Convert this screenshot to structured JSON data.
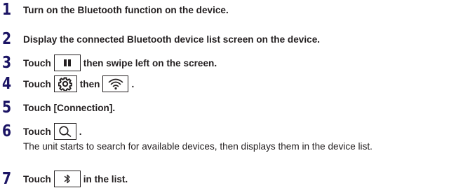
{
  "steps": [
    {
      "number": "1",
      "text": "Turn on the Bluetooth function on the device."
    },
    {
      "number": "2",
      "text": "Display the connected Bluetooth device list screen on the device."
    },
    {
      "number": "3",
      "before": "Touch",
      "after": "then swipe left on the screen.",
      "icon": "pause-icon"
    },
    {
      "number": "4",
      "before": "Touch",
      "middle": "then",
      "after": ".",
      "icon": "gear-icon",
      "icon2": "wifi-icon"
    },
    {
      "number": "5",
      "text": "Touch [Connection]."
    },
    {
      "number": "6",
      "before": "Touch",
      "after": ".",
      "icon": "search-icon",
      "note": "The unit starts to search for available devices, then displays them in the device list."
    },
    {
      "number": "7",
      "before": "Touch",
      "after": "in the list.",
      "icon": "bluetooth-icon"
    }
  ],
  "colors": {
    "step_number": "#1b1464",
    "text": "#231f20"
  }
}
